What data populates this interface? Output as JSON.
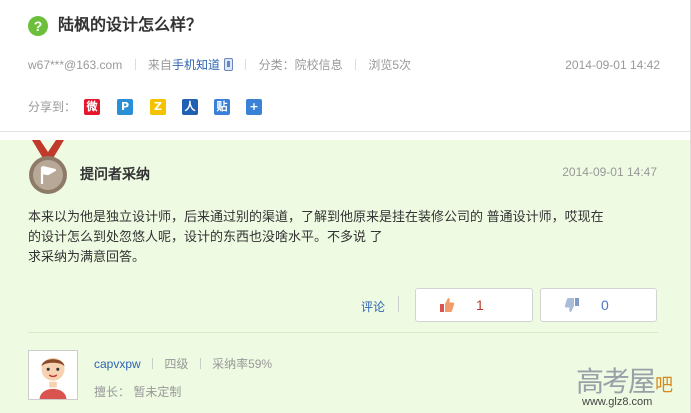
{
  "question": {
    "icon": "question-mark-icon",
    "icon_glyph": "?",
    "title": "陆枫的设计怎么样？"
  },
  "meta": {
    "author": "w67***@163.com",
    "source_prefix": "来自",
    "source_link": "手机知道",
    "source_icon": "phone-icon",
    "category": "分类：院校信息",
    "views": "浏览5次",
    "time": "2014-09-01 14:42"
  },
  "share": {
    "label": "分享到：",
    "targets": [
      {
        "name": "weibo-share-icon",
        "glyph": "微",
        "color": "#e6162d"
      },
      {
        "name": "tencent-weibo-share-icon",
        "glyph": "P",
        "color": "#2a8fd6"
      },
      {
        "name": "qzone-share-icon",
        "glyph": "Z",
        "color": "#f5c200"
      },
      {
        "name": "renren-share-icon",
        "glyph": "人",
        "color": "#1f5fb4"
      },
      {
        "name": "tieba-share-icon",
        "glyph": "贴",
        "color": "#3a7fd8"
      },
      {
        "name": "more-share-icon",
        "glyph": "+",
        "color": "#3a82d6"
      }
    ]
  },
  "answer": {
    "label": "提问者采纳",
    "time": "2014-09-01 14:47",
    "body_lines": [
      "本来以为他是独立设计师，后来通过别的渠道，了解到他原来是挂在装修公司的 普通设计师，哎现在",
      "的设计怎么到处忽悠人呢，设计的东西也没啥水平。不多说 了",
      "求采纳为满意回答。"
    ],
    "comment_label": "评论",
    "up_count": "1",
    "down_count": "0",
    "colors": {
      "accent_green": "#6cbf3a",
      "answer_bg": "#eefae2",
      "link_blue": "#2d64b3",
      "up_red": "#c0392b"
    }
  },
  "user": {
    "name": "capvxpw",
    "level": "四级",
    "adopt_rate": "采纳率59%",
    "specialty": "擅长： 暂未定制"
  },
  "watermark": {
    "chars": "高考屋",
    "suffix": "吧",
    "url": "www.glz8.com"
  }
}
